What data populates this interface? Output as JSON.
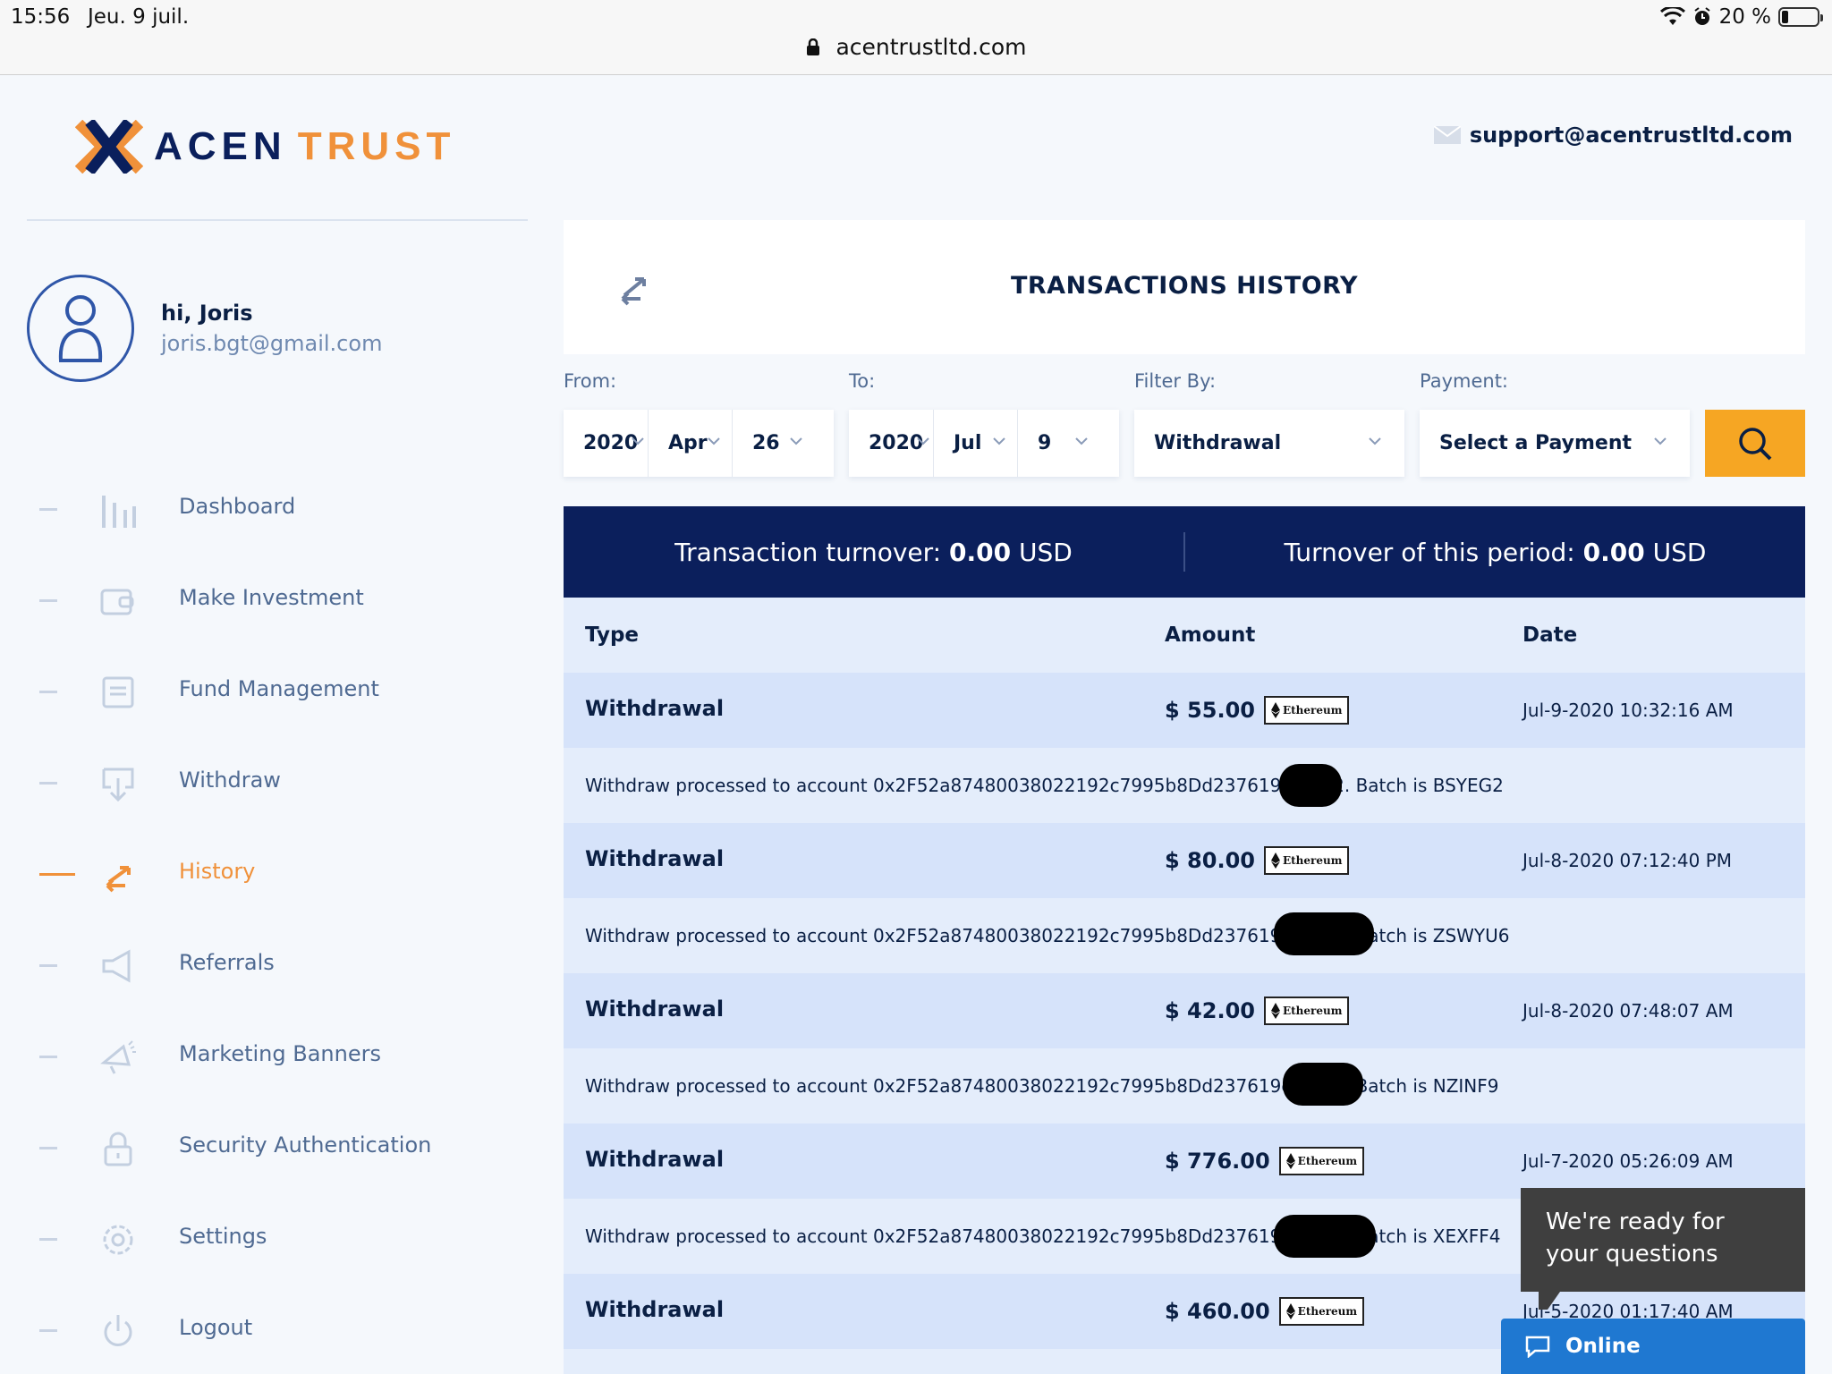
{
  "status_bar": {
    "time": "15:56",
    "date": "Jeu. 9 juil.",
    "battery": "20 %"
  },
  "browser": {
    "url": "acentrustltd.com"
  },
  "header": {
    "logo_part1": "ACEN",
    "logo_part2": "TRUST",
    "support_email": "support@acentrustltd.com"
  },
  "profile": {
    "greeting": "hi, Joris",
    "email": "joris.bgt@gmail.com"
  },
  "sidebar": {
    "items": [
      {
        "label": "Dashboard"
      },
      {
        "label": "Make Investment"
      },
      {
        "label": "Fund Management"
      },
      {
        "label": "Withdraw"
      },
      {
        "label": "History",
        "active": true
      },
      {
        "label": "Referrals"
      },
      {
        "label": "Marketing Banners"
      },
      {
        "label": "Security Authentication"
      },
      {
        "label": "Settings"
      },
      {
        "label": "Logout"
      }
    ]
  },
  "page": {
    "title": "TRANSACTIONS HISTORY"
  },
  "filters": {
    "from_label": "From:",
    "to_label": "To:",
    "filter_label": "Filter By:",
    "payment_label": "Payment:",
    "from": {
      "year": "2020",
      "month": "Apr",
      "day": "26"
    },
    "to": {
      "year": "2020",
      "month": "Jul",
      "day": "9"
    },
    "filter_by": "Withdrawal",
    "payment": "Select a Payment"
  },
  "turnover": {
    "transaction_label": "Transaction turnover:",
    "transaction_value": "0.00",
    "period_label": "Turnover of this period:",
    "period_value": "0.00",
    "currency": "USD"
  },
  "table": {
    "headers": {
      "type": "Type",
      "amount": "Amount",
      "date": "Date"
    },
    "rows": [
      {
        "type": "Withdrawal",
        "amount": "$ 55.00",
        "method": "Ethereum",
        "date": "Jul-9-2020 10:32:16 AM",
        "detail": "Withdraw processed to account 0x2F52a87480038022192c7995b8Dd237619eFDIE2. Batch is BSYEG2"
      },
      {
        "type": "Withdrawal",
        "amount": "$ 80.00",
        "method": "Ethereum",
        "date": "Jul-8-2020 07:12:40 PM",
        "detail": "Withdraw processed to account 0x2F52a87480038022192c7995b8Dd237619eFDIE2. Batch is ZSWYU6"
      },
      {
        "type": "Withdrawal",
        "amount": "$ 42.00",
        "method": "Ethereum",
        "date": "Jul-8-2020 07:48:07 AM",
        "detail": "Withdraw processed to account 0x2F52a87480038022192c7995b8Dd237619eFDIE2. Batch is NZINF9"
      },
      {
        "type": "Withdrawal",
        "amount": "$ 776.00",
        "method": "Ethereum",
        "date": "Jul-7-2020 05:26:09 AM",
        "detail": "Withdraw processed to account 0x2F52a87480038022192c7995b8Dd237619eFDIE2. Batch is XEXFF4"
      },
      {
        "type": "Withdrawal",
        "amount": "$ 460.00",
        "method": "Ethereum",
        "date": "Jul-5-2020 01:17:40 AM"
      }
    ]
  },
  "chat": {
    "message": "We're ready for your questions",
    "status": "Online"
  },
  "colors": {
    "accent": "#f0913a",
    "navy": "#0b1f5c",
    "search": "#f6a623",
    "chat": "#1f78d1"
  }
}
